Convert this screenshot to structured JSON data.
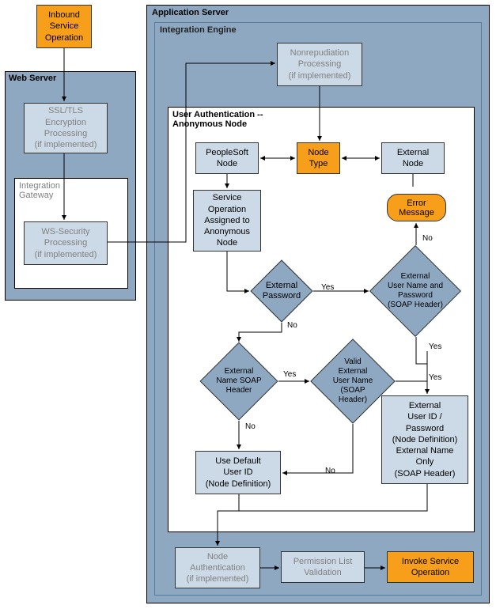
{
  "inbound": "Inbound\nService\nOperation",
  "webserver_title": "Web Server",
  "ssl": "SSL/TLS\nEncryption\nProcessing\n(if implemented)",
  "ig_title": "Integration\nGateway",
  "ws": "WS-Security\nProcessing\n(if implemented)",
  "appserver_title": "Application Server",
  "intengine_title": "Integration Engine",
  "nonrep": "Nonrepudiation\nProcessing\n(if implemented)",
  "auth_title": "User Authentication --\nAnonymous Node",
  "psoft": "PeopleSoft\nNode",
  "nodetype": "Node\nType",
  "extnode": "External\nNode",
  "svcop": "Service\nOperation\nAssigned to\nAnonymous\nNode",
  "errmsg": "Error\nMessage",
  "extpwd": "External\nPassword",
  "extunpwd": "External\nUser Name and\nPassword\n(SOAP Header)",
  "extname": "External\nName SOAP\nHeader",
  "validext": "Valid\nExternal\nUser Name\n(SOAP\nHeader)",
  "usedefault": "Use Default\nUser ID\n(Node Definition)",
  "extidpwd": "External\nUser ID /\nPassword\n(Node Definition)\nExternal Name\nOnly\n(SOAP Header)",
  "nodeauth": "Node\nAuthentication\n(if implemented)",
  "permlist": "Permission List\nValidation",
  "invoke": "Invoke Service\nOperation",
  "yes": "Yes",
  "no": "No"
}
